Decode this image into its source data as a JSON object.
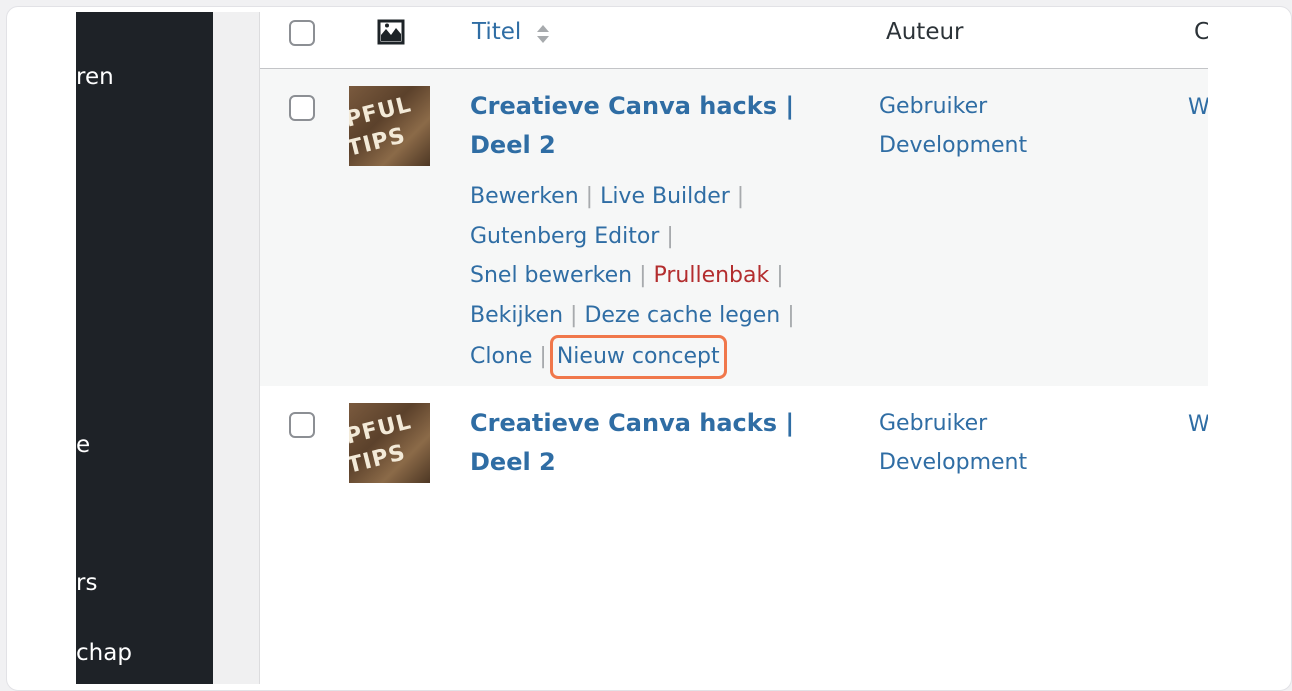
{
  "sidebar": {
    "items": [
      {
        "label": "ren"
      },
      {
        "label": "e"
      },
      {
        "label": "rs"
      },
      {
        "label": "chap"
      }
    ]
  },
  "table": {
    "header": {
      "thumbnail_icon": "image-icon",
      "title": "Titel",
      "author": "Auteur",
      "category": "C"
    },
    "rows": [
      {
        "title": "Creatieve Canva hacks | Deel 2",
        "thumb_text": [
          "PFUL",
          "TIPS"
        ],
        "author": "Gebruiker Development",
        "category": "W",
        "actions": {
          "edit": "Bewerken",
          "live_builder": "Live Builder",
          "gutenberg": "Gutenberg Editor",
          "quick_edit": "Snel bewerken",
          "trash": "Prullenbak",
          "view": "Bekijken",
          "clear_cache": "Deze cache legen",
          "clone": "Clone",
          "new_draft": "Nieuw concept"
        }
      },
      {
        "title": "Creatieve Canva hacks | Deel 2",
        "thumb_text": [
          "PFUL",
          "TIPS"
        ],
        "author": "Gebruiker Development",
        "category": "W"
      }
    ]
  },
  "colors": {
    "link": "#2f6da4",
    "trash": "#b32d2e",
    "highlight": "#f0774b",
    "sidebar": "#1e2227"
  }
}
